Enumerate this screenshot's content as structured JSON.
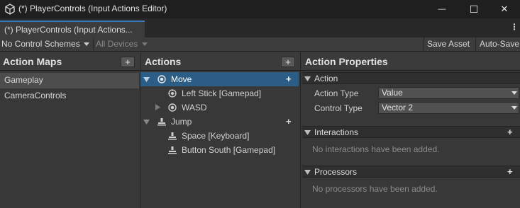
{
  "window": {
    "title": "(*) PlayerControls (Input Actions Editor)",
    "minimize_glyph": "—",
    "maximize_glyph": "☐",
    "close_glyph": "✕"
  },
  "tabs": [
    {
      "label": "(*) PlayerControls (Input Actions...",
      "active": true
    }
  ],
  "tab_menu_glyph": "⋮",
  "toolbar": {
    "control_schemes": "No Control Schemes",
    "devices": "All Devices",
    "save_asset": "Save Asset",
    "auto_save": "Auto-Save"
  },
  "action_maps": {
    "title": "Action Maps",
    "add_glyph": "+",
    "items": [
      {
        "label": "Gameplay",
        "selected": true
      },
      {
        "label": "CameraControls",
        "selected": false
      }
    ]
  },
  "actions": {
    "title": "Actions",
    "add_glyph": "+",
    "items": [
      {
        "label": "Move",
        "kind": "action-value",
        "selected": true,
        "expanded": true
      },
      {
        "label": "Left Stick [Gamepad]",
        "kind": "binding-stick"
      },
      {
        "label": "WASD",
        "kind": "composite",
        "expanded": false
      },
      {
        "label": "Jump",
        "kind": "action-button",
        "expanded": true
      },
      {
        "label": "Space [Keyboard]",
        "kind": "binding-button"
      },
      {
        "label": "Button South [Gamepad]",
        "kind": "binding-button"
      }
    ]
  },
  "properties": {
    "title": "Action Properties",
    "action_section": "Action",
    "action_type_label": "Action Type",
    "action_type_value": "Value",
    "control_type_label": "Control Type",
    "control_type_value": "Vector 2",
    "interactions_label": "Interactions",
    "interactions_empty": "No interactions have been added.",
    "processors_label": "Processors",
    "processors_empty": "No processors have been added.",
    "add_glyph": "+"
  },
  "colors": {
    "selection": "#2c5d87",
    "tab_accent": "#3a79bb",
    "background": "#383838"
  }
}
